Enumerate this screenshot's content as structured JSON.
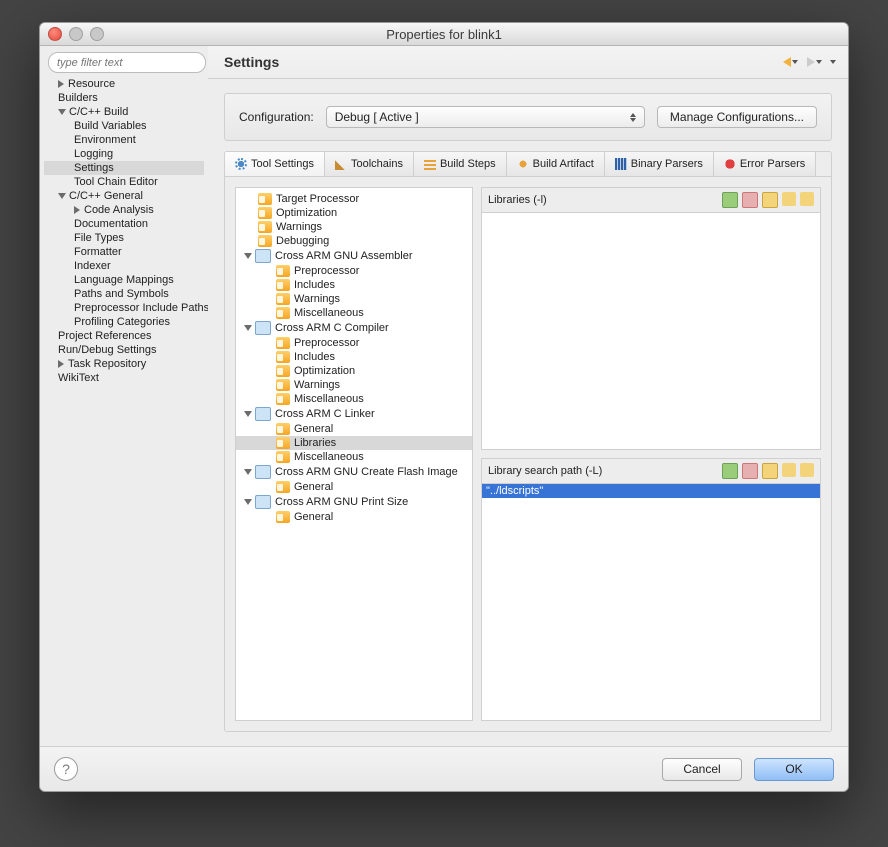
{
  "window": {
    "title": "Properties for blink1"
  },
  "filter": {
    "placeholder": "type filter text"
  },
  "nav": {
    "items": [
      {
        "label": "Resource",
        "arrow": "right",
        "lvl": 1
      },
      {
        "label": "Builders",
        "lvl": 1
      },
      {
        "label": "C/C++ Build",
        "arrow": "down",
        "lvl": 1
      },
      {
        "label": "Build Variables",
        "lvl": 2
      },
      {
        "label": "Environment",
        "lvl": 2
      },
      {
        "label": "Logging",
        "lvl": 2
      },
      {
        "label": "Settings",
        "lvl": 2,
        "selected": true
      },
      {
        "label": "Tool Chain Editor",
        "lvl": 2
      },
      {
        "label": "C/C++ General",
        "arrow": "down",
        "lvl": 1
      },
      {
        "label": "Code Analysis",
        "arrow": "right",
        "lvl": 2
      },
      {
        "label": "Documentation",
        "lvl": 2
      },
      {
        "label": "File Types",
        "lvl": 2
      },
      {
        "label": "Formatter",
        "lvl": 2
      },
      {
        "label": "Indexer",
        "lvl": 2
      },
      {
        "label": "Language Mappings",
        "lvl": 2
      },
      {
        "label": "Paths and Symbols",
        "lvl": 2
      },
      {
        "label": "Preprocessor Include Paths",
        "lvl": 2
      },
      {
        "label": "Profiling Categories",
        "lvl": 2
      },
      {
        "label": "Project References",
        "lvl": 1
      },
      {
        "label": "Run/Debug Settings",
        "lvl": 1
      },
      {
        "label": "Task Repository",
        "arrow": "right",
        "lvl": 1
      },
      {
        "label": "WikiText",
        "lvl": 1
      }
    ]
  },
  "header": {
    "title": "Settings"
  },
  "config": {
    "label": "Configuration:",
    "value": "Debug  [ Active ]",
    "manage": "Manage Configurations..."
  },
  "tabs": [
    {
      "label": "Tool Settings",
      "icon": "gear",
      "active": true
    },
    {
      "label": "Toolchains",
      "icon": "wand"
    },
    {
      "label": "Build Steps",
      "icon": "steps"
    },
    {
      "label": "Build Artifact",
      "icon": "cup"
    },
    {
      "label": "Binary Parsers",
      "icon": "bin"
    },
    {
      "label": "Error Parsers",
      "icon": "err"
    }
  ],
  "settingsTree": [
    {
      "label": "Target Processor",
      "lvl": 1,
      "icon": "folder"
    },
    {
      "label": "Optimization",
      "lvl": 1,
      "icon": "folder"
    },
    {
      "label": "Warnings",
      "lvl": 1,
      "icon": "folder"
    },
    {
      "label": "Debugging",
      "lvl": 1,
      "icon": "folder"
    },
    {
      "label": "Cross ARM GNU Assembler",
      "lvl": 0,
      "icon": "tool",
      "arrow": "down"
    },
    {
      "label": "Preprocessor",
      "lvl": 2,
      "icon": "folder"
    },
    {
      "label": "Includes",
      "lvl": 2,
      "icon": "folder"
    },
    {
      "label": "Warnings",
      "lvl": 2,
      "icon": "folder"
    },
    {
      "label": "Miscellaneous",
      "lvl": 2,
      "icon": "folder"
    },
    {
      "label": "Cross ARM C Compiler",
      "lvl": 0,
      "icon": "tool",
      "arrow": "down"
    },
    {
      "label": "Preprocessor",
      "lvl": 2,
      "icon": "folder"
    },
    {
      "label": "Includes",
      "lvl": 2,
      "icon": "folder"
    },
    {
      "label": "Optimization",
      "lvl": 2,
      "icon": "folder"
    },
    {
      "label": "Warnings",
      "lvl": 2,
      "icon": "folder"
    },
    {
      "label": "Miscellaneous",
      "lvl": 2,
      "icon": "folder"
    },
    {
      "label": "Cross ARM C Linker",
      "lvl": 0,
      "icon": "tool",
      "arrow": "down"
    },
    {
      "label": "General",
      "lvl": 2,
      "icon": "folder"
    },
    {
      "label": "Libraries",
      "lvl": 2,
      "icon": "folder",
      "selected": true
    },
    {
      "label": "Miscellaneous",
      "lvl": 2,
      "icon": "folder"
    },
    {
      "label": "Cross ARM GNU Create Flash Image",
      "lvl": 0,
      "icon": "tool",
      "arrow": "down"
    },
    {
      "label": "General",
      "lvl": 2,
      "icon": "folder"
    },
    {
      "label": "Cross ARM GNU Print Size",
      "lvl": 0,
      "icon": "tool",
      "arrow": "down"
    },
    {
      "label": "General",
      "lvl": 2,
      "icon": "folder"
    }
  ],
  "panes": {
    "libs": {
      "title": "Libraries (-l)",
      "items": []
    },
    "paths": {
      "title": "Library search path (-L)",
      "items": [
        "\"../ldscripts\""
      ]
    }
  },
  "footer": {
    "cancel": "Cancel",
    "ok": "OK"
  }
}
